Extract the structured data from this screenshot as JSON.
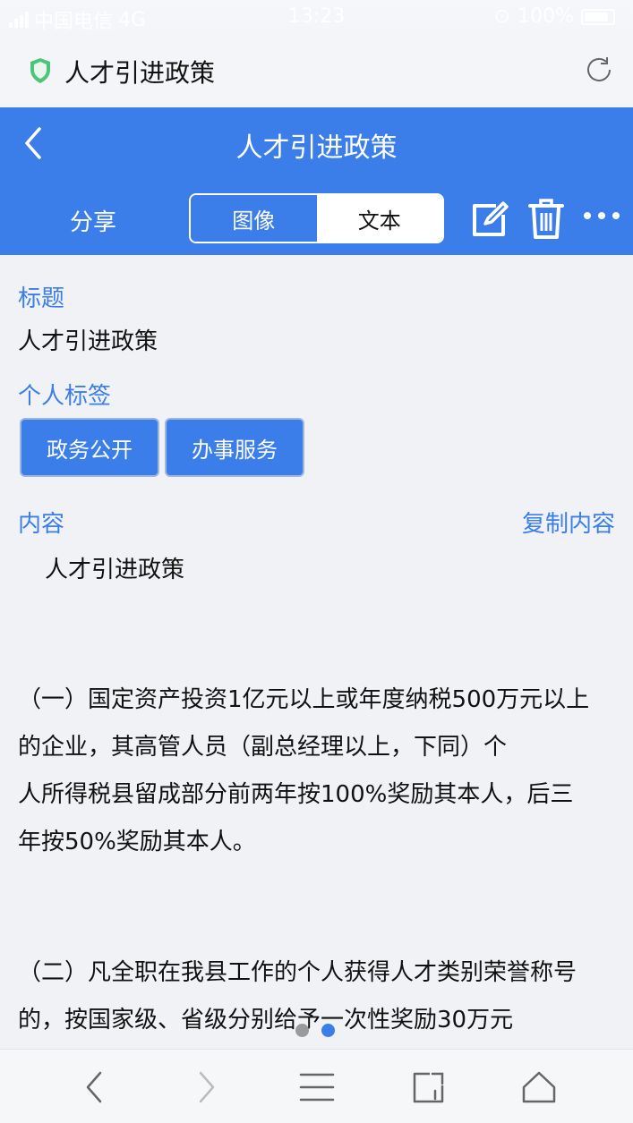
{
  "status_bar": {
    "carrier": "中国电信",
    "network": "4G",
    "time": "13:23",
    "battery": "100%"
  },
  "browser": {
    "title": "人才引进政策",
    "icons": {
      "security": "shield-icon",
      "reload": "reload-icon"
    }
  },
  "header": {
    "title": "人才引进政策",
    "share_label": "分享",
    "segment": {
      "image_label": "图像",
      "text_label": "文本",
      "selected": "文本"
    },
    "icons": {
      "back": "back-icon",
      "edit": "edit-icon",
      "delete": "trash-icon",
      "more": "more-icon"
    }
  },
  "document": {
    "title_label": "标题",
    "title_value": "人才引进政策",
    "tags_label": "个人标签",
    "tags": [
      "政务公开",
      "办事服务"
    ],
    "content_label": "内容",
    "copy_label": "复制内容",
    "content_heading": "人才引进政策",
    "paragraphs": [
      [
        "（一）国定资产投资1亿元以上或年度纳税500万元以上",
        "的企业，其高管人员（副总经理以上，下同）个",
        "人所得税县留成部分前两年按100%奖励其本人，后三",
        "年按50%奖励其本人。"
      ],
      [
        "（二）凡全职在我县工作的个人获得人才类别荣誉称号",
        "的，按国家级、省级分别给予一次性奖励30万元"
      ]
    ]
  },
  "pager": {
    "dots": 2,
    "active_index": 1
  },
  "bottom_bar": {
    "icons": [
      "back-arrow-icon",
      "forward-arrow-icon",
      "menu-icon",
      "tabs-icon",
      "home-icon"
    ]
  },
  "colors": {
    "accent": "#3b7ee9",
    "background": "#f1f2f6"
  }
}
